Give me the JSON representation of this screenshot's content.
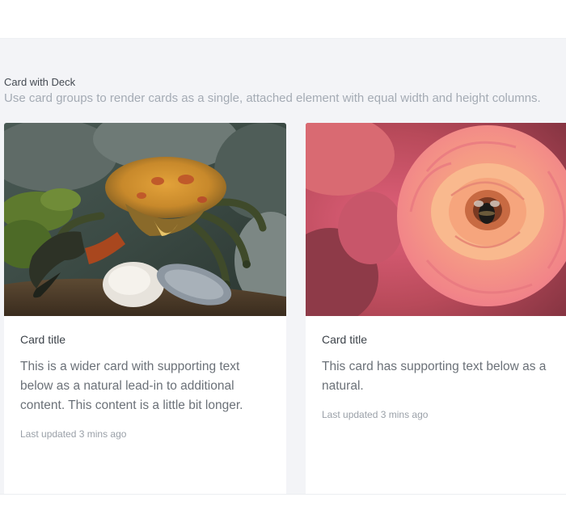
{
  "section": {
    "title": "Card with Deck",
    "subtitle": "Use card groups to render cards as a single, attached element with equal width and height columns."
  },
  "cards": [
    {
      "title": "Card title",
      "text": "This is a wider card with supporting text below as a natural lead-in to additional content. This content is a little bit longer.",
      "meta": "Last updated 3 mins ago",
      "image_subject": "crab-photo"
    },
    {
      "title": "Card title",
      "text": "This card has supporting text below as a natural.",
      "meta": "Last updated 3 mins ago",
      "image_subject": "rose-photo"
    }
  ],
  "colors": {
    "page_background": "#f3f4f7",
    "card_background": "#ffffff",
    "title_text": "#3d434a",
    "body_text": "#6b7178",
    "muted_text": "#9aa0a8"
  }
}
